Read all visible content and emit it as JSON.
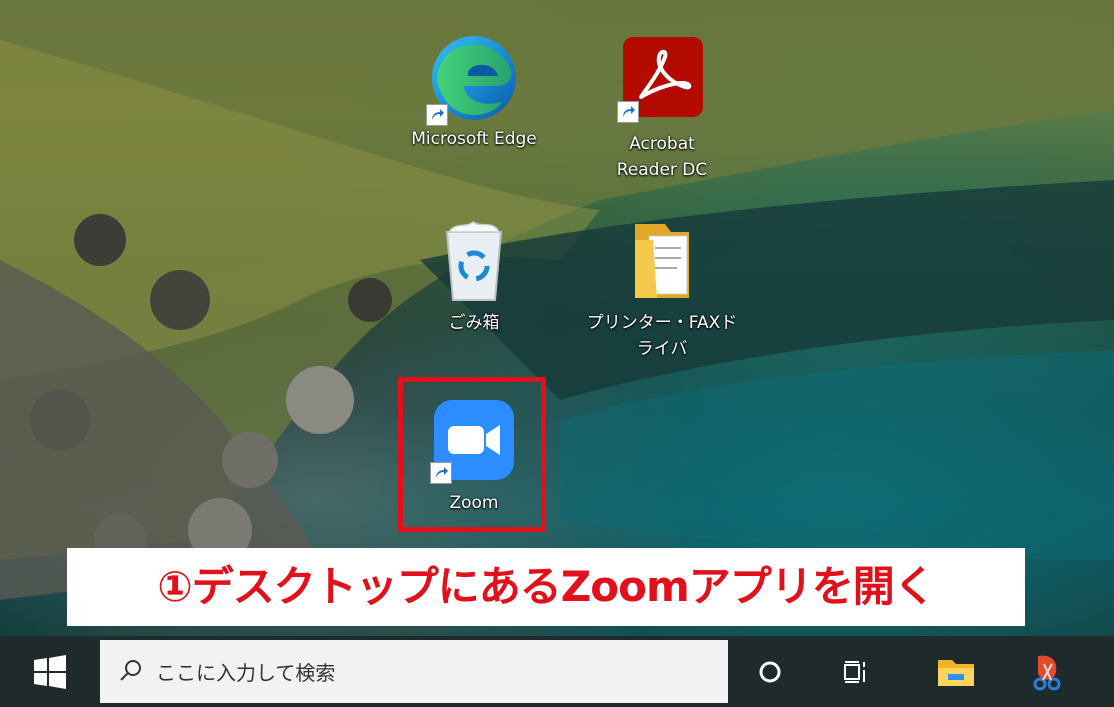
{
  "desktop": {
    "icons": [
      {
        "label": "Microsoft Edge",
        "icon": "edge-icon"
      },
      {
        "label": "Acrobat Reader DC",
        "icon": "acrobat-icon"
      },
      {
        "label": "ごみ箱",
        "icon": "recycle-bin-icon"
      },
      {
        "label": "プリンター・FAXドライバ",
        "icon": "folder-icon"
      },
      {
        "label": "Zoom",
        "icon": "zoom-icon"
      }
    ]
  },
  "annotation": {
    "text": "①デスクトップにあるZoomアプリを開く",
    "color": "#e2101a"
  },
  "taskbar": {
    "search_placeholder": "ここに入力して検索",
    "items": [
      "start-icon",
      "cortana-icon",
      "task-view-icon",
      "file-explorer-icon",
      "snipping-tool-icon"
    ]
  }
}
